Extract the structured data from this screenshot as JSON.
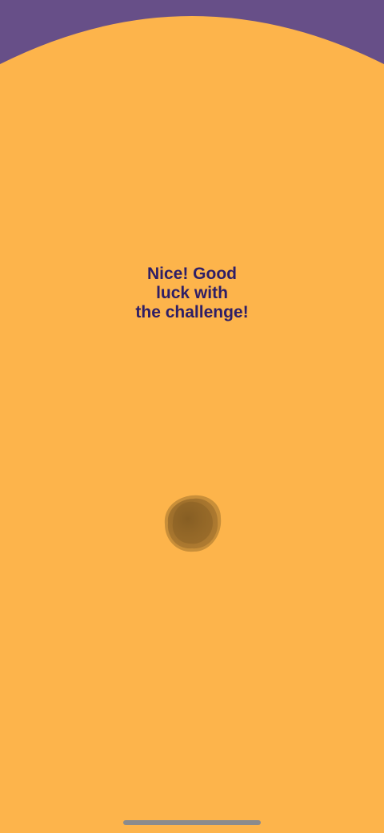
{
  "colors": {
    "background_top": "#674f88",
    "main_background": "#fdb44b",
    "text": "#2e1e66",
    "blob": "#8a6224",
    "home_indicator": "#8b8b8d"
  },
  "message": {
    "lines": [
      "Nice! Good",
      "luck with",
      "the challenge!"
    ]
  },
  "icons": {
    "blob": "brown-blob-icon"
  }
}
